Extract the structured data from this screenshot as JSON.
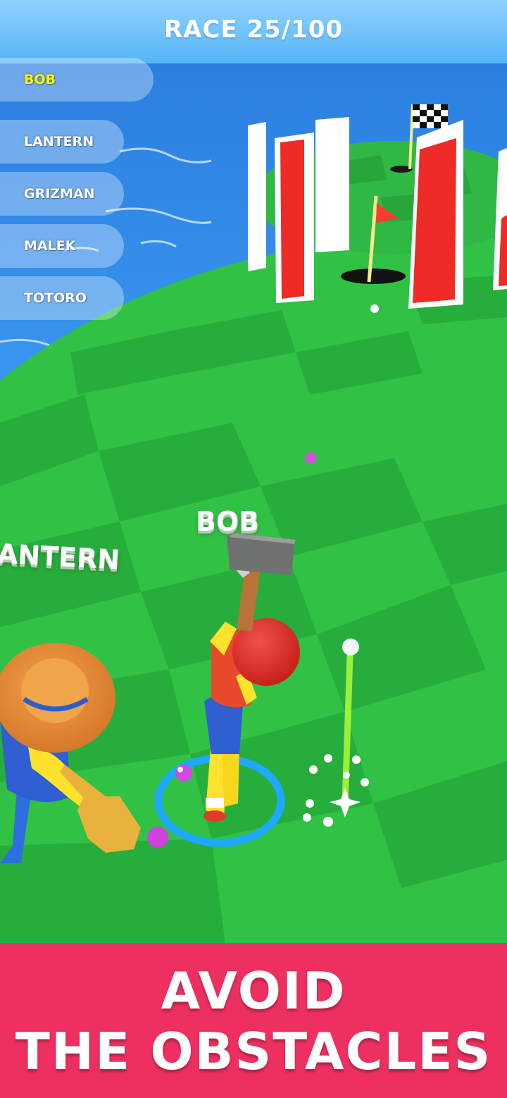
{
  "hud": {
    "race_label": "RACE 25/100"
  },
  "leaderboard": [
    {
      "name": "BOB",
      "highlight": true
    },
    {
      "name": "LANTERN",
      "highlight": false
    },
    {
      "name": "GRIZMAN",
      "highlight": false
    },
    {
      "name": "MALEK",
      "highlight": false
    },
    {
      "name": "TOTORO",
      "highlight": false
    }
  ],
  "players": {
    "player_name": "BOB",
    "rival_name": "ANTERN"
  },
  "banner": {
    "line1": "AVOID",
    "line2": "THE OBSTACLES"
  },
  "colors": {
    "sky": "#4aa8f0",
    "water": "#2f86e0",
    "grass_light": "#3ed052",
    "grass_dark": "#26b03d",
    "banner": "#ee3060",
    "highlight_text": "#fff200",
    "aim_ring": "#1ea8ff"
  }
}
